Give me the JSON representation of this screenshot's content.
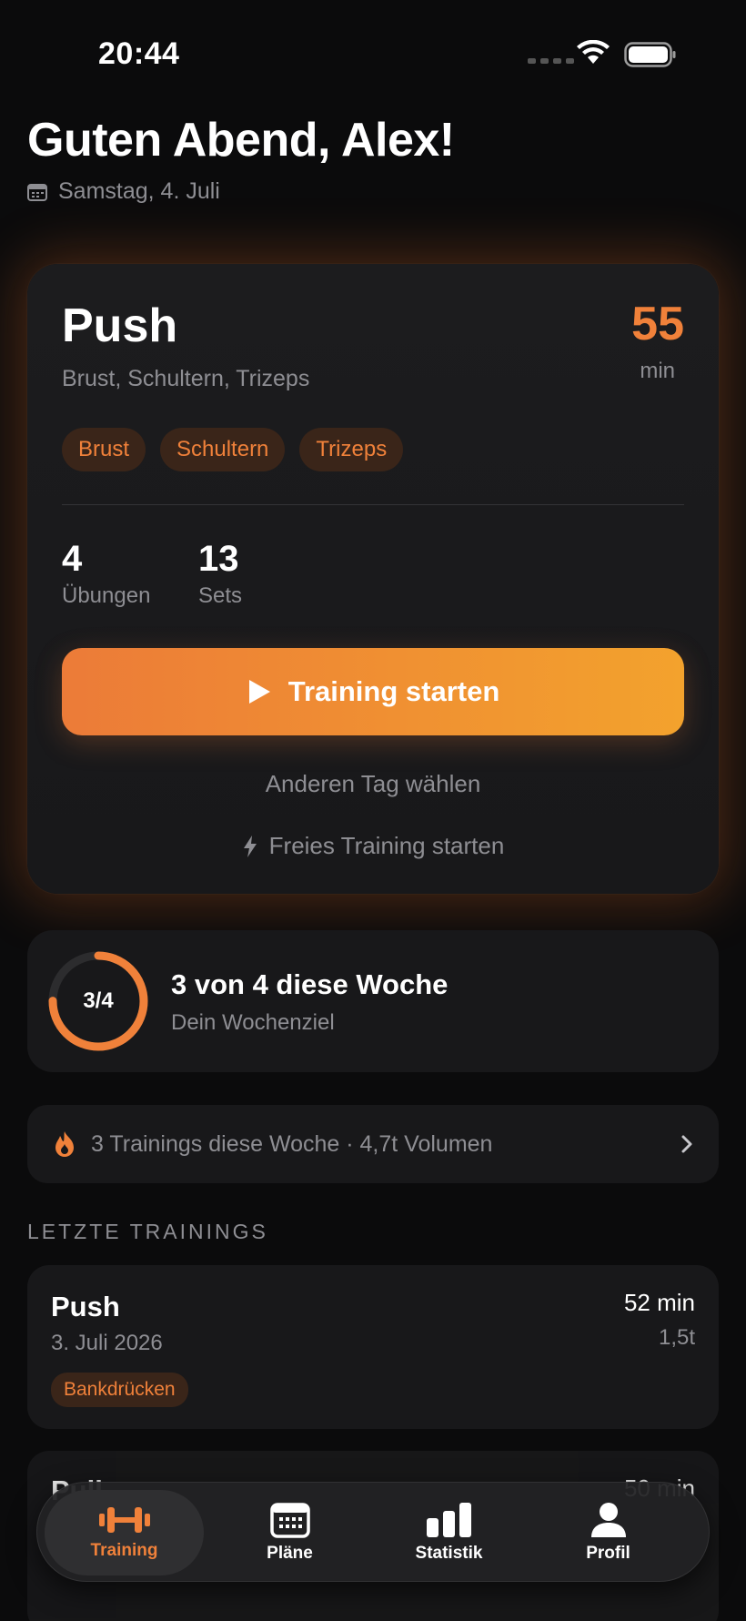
{
  "status_bar": {
    "time": "20:44"
  },
  "header": {
    "greeting": "Guten Abend, Alex!",
    "date": "Samstag, 4. Juli"
  },
  "today": {
    "title": "Push",
    "subtitle": "Brust, Schultern, Trizeps",
    "duration_value": "55",
    "duration_unit": "min",
    "tags": [
      "Brust",
      "Schultern",
      "Trizeps"
    ],
    "stats": [
      {
        "value": "4",
        "label": "Übungen"
      },
      {
        "value": "13",
        "label": "Sets"
      }
    ],
    "start_label": "Training starten",
    "other_day_label": "Anderen Tag wählen",
    "free_training_label": "Freies Training starten"
  },
  "weekly_goal": {
    "ring_label": "3/4",
    "completed": 3,
    "target": 4,
    "title": "3 von 4 diese Woche",
    "subtitle": "Dein Wochenziel"
  },
  "summary": {
    "text": "3 Trainings diese Woche · 4,7t Volumen"
  },
  "recent": {
    "header": "LETZTE TRAININGS",
    "items": [
      {
        "name": "Push",
        "date": "3. Juli 2026",
        "duration": "52 min",
        "volume": "1,5t",
        "tag": "Bankdrücken"
      },
      {
        "name": "Pull",
        "duration": "50 min"
      }
    ]
  },
  "tab_bar": {
    "tabs": [
      {
        "label": "Training",
        "icon": "dumbbell-icon",
        "active": true
      },
      {
        "label": "Pläne",
        "icon": "calendar-icon"
      },
      {
        "label": "Statistik",
        "icon": "bar-chart-icon"
      },
      {
        "label": "Profil",
        "icon": "person-icon"
      }
    ]
  },
  "colors": {
    "accent": "#f0813a",
    "accent_end": "#f3a22d",
    "background": "#0b0b0c",
    "card": "#18181a"
  }
}
